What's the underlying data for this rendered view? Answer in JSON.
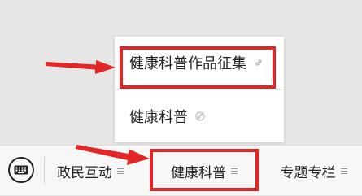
{
  "popup_menu": {
    "items": [
      {
        "label": "健康科普作品征集",
        "icon": "link-icon"
      },
      {
        "label": "健康科普",
        "icon": "link-icon"
      }
    ]
  },
  "bottom_bar": {
    "keyboard_icon": "keyboard-icon",
    "tabs": [
      {
        "label": "政民互动",
        "icon": "menu-lines-icon"
      },
      {
        "label": "健康科普",
        "icon": "menu-lines-icon"
      },
      {
        "label": "专题专栏",
        "icon": "menu-lines-icon"
      }
    ]
  },
  "colors": {
    "highlight_red": "#e32525",
    "background": "#e6e6e6",
    "bar_background": "#f7f7f7"
  }
}
